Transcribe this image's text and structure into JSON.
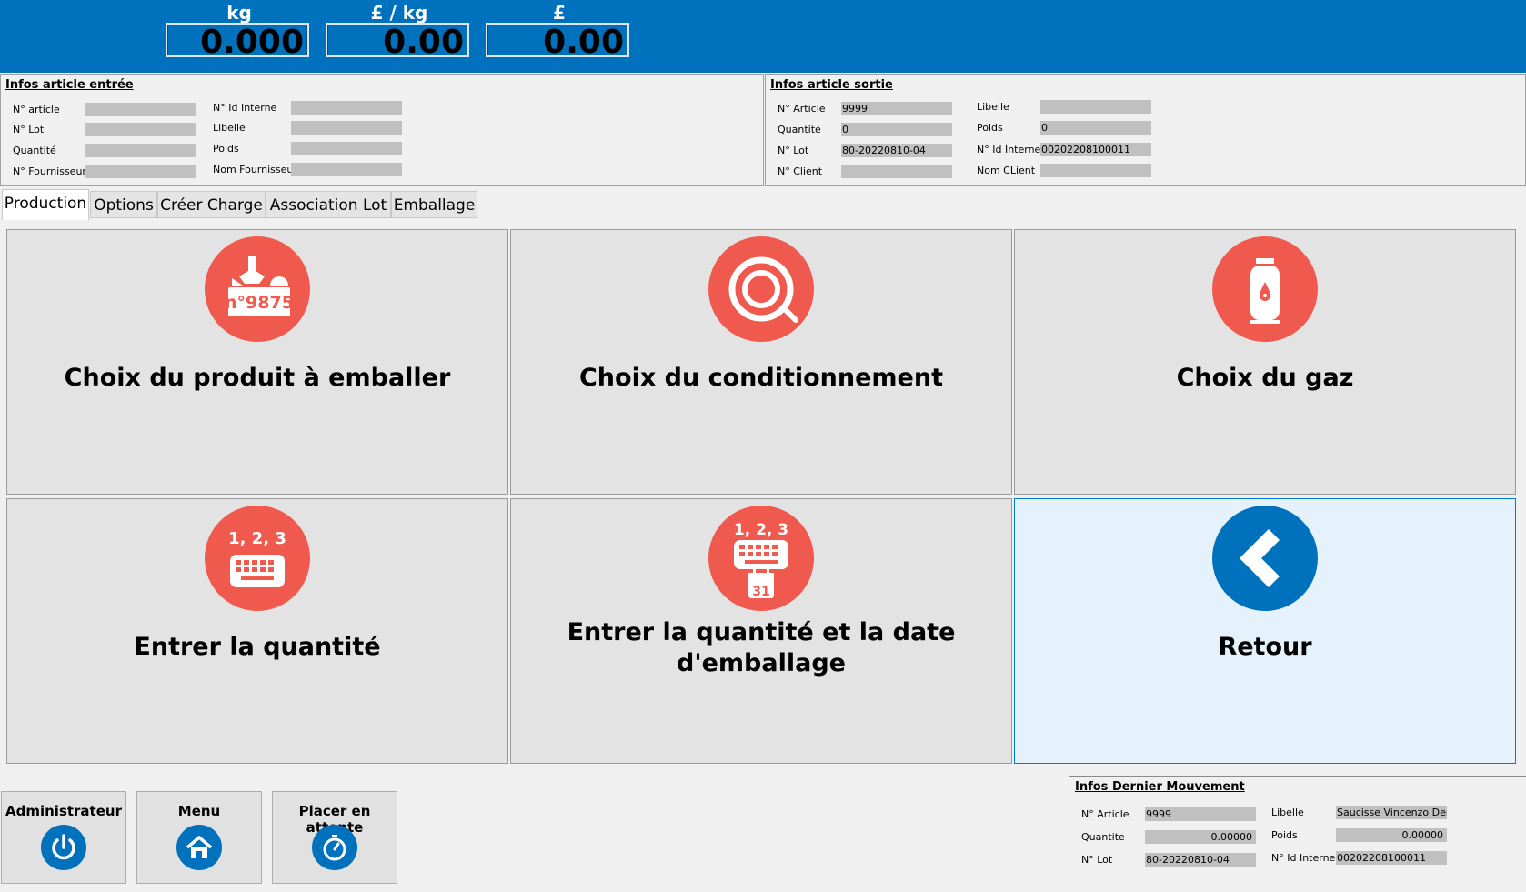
{
  "scale": {
    "weight": {
      "label": "kg",
      "value": "0.000"
    },
    "price_per_kg": {
      "label": "£ / kg",
      "value": "0.00"
    },
    "price": {
      "label": "£",
      "value": "0.00"
    }
  },
  "input_article": {
    "title": "Infos article entrée",
    "labels": {
      "article_no": "N° article",
      "lot_no": "N° Lot",
      "quantity": "Quantité",
      "supplier_no": "N° Fournisseur",
      "internal_id": "N° Id Interne",
      "libelle": "Libelle",
      "poids": "Poids",
      "supplier_name": "Nom Fournisseur"
    },
    "values": {
      "article_no": "",
      "lot_no": "",
      "quantity": "",
      "supplier_no": "",
      "internal_id": "",
      "libelle": "",
      "poids": "",
      "supplier_name": ""
    }
  },
  "output_article": {
    "title": "Infos article sortie",
    "labels": {
      "article_no": "N° Article",
      "quantity": "Quantité",
      "lot_no": "N° Lot",
      "client_no": "N° Client",
      "libelle": "Libelle",
      "poids": "Poids",
      "internal_id": "N° Id Interne",
      "client_name": "Nom CLient"
    },
    "values": {
      "article_no": "9999",
      "quantity": "0",
      "lot_no": "80-20220810-04",
      "client_no": "",
      "libelle": "",
      "poids": "0",
      "internal_id": "00202208100011",
      "client_name": ""
    }
  },
  "tabs": [
    "Production",
    "Options",
    "Créer Charge",
    "Association Lot",
    "Emballage"
  ],
  "tiles": {
    "product": {
      "label": "Choix du produit à emballer",
      "icon_text": "n°9875"
    },
    "packaging": {
      "label": "Choix du conditionnement"
    },
    "gas": {
      "label": "Choix du gaz"
    },
    "quantity": {
      "label": "Entrer la quantité",
      "icon_text": "1, 2, 3"
    },
    "quantity_date": {
      "label_line1": "Entrer la quantité et la date",
      "label_line2": "d'emballage",
      "icon_text": "1, 2, 3",
      "calendar_day": "31"
    },
    "back": {
      "label": "Retour"
    }
  },
  "bottom_buttons": {
    "admin": "Administrateur",
    "menu": "Menu",
    "hold": "Placer en attente"
  },
  "last_movement": {
    "title": "Infos Dernier Mouvement",
    "labels": {
      "article_no": "N° Article",
      "quantity": "Quantite",
      "lot_no": "N° Lot",
      "libelle": "Libelle",
      "poids": "Poids",
      "internal_id": "N° Id Interne"
    },
    "values": {
      "article_no": "9999",
      "quantity": "0.00000",
      "lot_no": "80-20220810-04",
      "libelle": "Saucisse Vincenzo Demo",
      "poids": "0.00000",
      "internal_id": "00202208100011"
    }
  },
  "colors": {
    "header_blue": "#0071bc",
    "tile_red": "#f0594d",
    "tile_grey": "#e3e3e3",
    "highlight_tile": "#e5f1fb"
  }
}
